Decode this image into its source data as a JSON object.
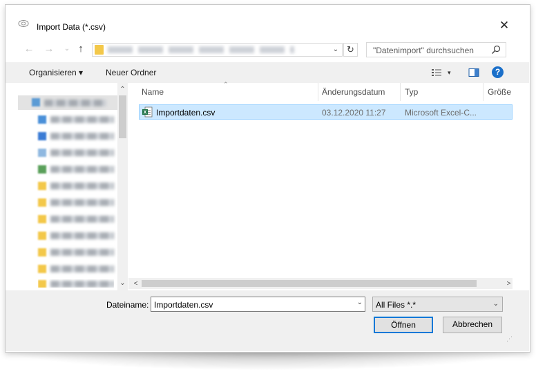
{
  "window": {
    "title": "Import Data (*.csv)",
    "close_glyph": "✕",
    "icon": "app-icon"
  },
  "nav": {
    "back_glyph": "←",
    "forward_glyph": "→",
    "recent_glyph": "⌄",
    "up_glyph": "↑",
    "refresh_glyph": "↻",
    "address_dropdown_glyph": "⌄"
  },
  "search": {
    "placeholder": "\"Datenimport\" durchsuchen",
    "icon": "search-icon"
  },
  "toolbar": {
    "organize_label": "Organisieren ▾",
    "new_folder_label": "Neuer Ordner",
    "view_dropdown_glyph": "▾",
    "help_glyph": "?"
  },
  "columns": {
    "name": "Name",
    "date": "Änderungsdatum",
    "type": "Typ",
    "size": "Größe"
  },
  "files": [
    {
      "name": "Importdaten.csv",
      "date": "03.12.2020 11:27",
      "type": "Microsoft Excel-C..."
    }
  ],
  "scroll": {
    "up_glyph": "⌃",
    "down_glyph": "⌄",
    "left_glyph": "<",
    "right_glyph": ">"
  },
  "bottom": {
    "filename_label": "Dateiname:",
    "filename_value": "Importdaten.csv",
    "filename_dropdown_glyph": "⌄",
    "filetype_value": "All Files *.*",
    "filetype_dropdown_glyph": "⌄",
    "open_label": "Öffnen",
    "cancel_label": "Abbrechen",
    "grip_glyph": "⋰"
  },
  "colors": {
    "selection_fill": "#cce8ff",
    "selection_border": "#99d1ff",
    "accent": "#0078d7",
    "help": "#1a6fc9",
    "excel": "#1e7145",
    "folder": "#f3c84a"
  }
}
